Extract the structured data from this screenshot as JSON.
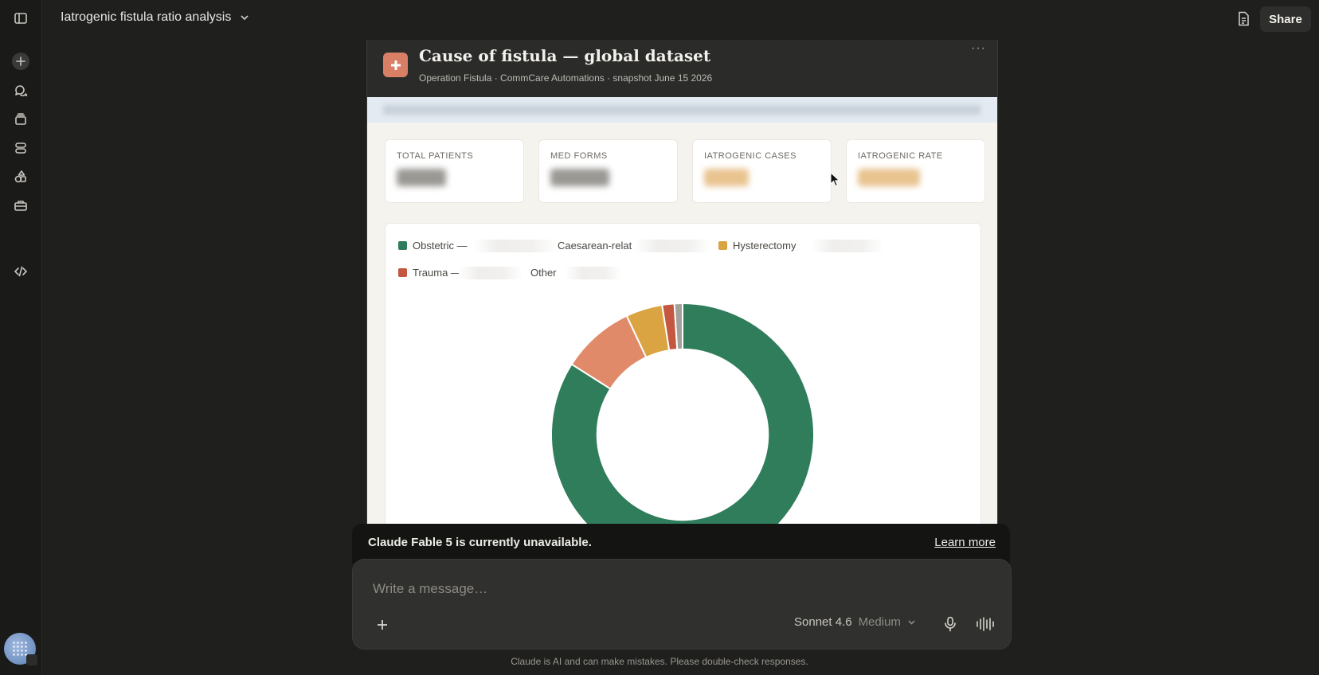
{
  "conversation": {
    "title": "Iatrogenic fistula ratio analysis"
  },
  "header": {
    "share_label": "Share"
  },
  "artifact": {
    "title": "Cause of fistula — global dataset",
    "subtitle": "Operation Fistula · CommCare Automations · snapshot June 15 2026",
    "more_label": "···",
    "kpis": [
      {
        "label": "TOTAL PATIENTS",
        "color": "#9a9893"
      },
      {
        "label": "MED FORMS",
        "color": "#9a9893"
      },
      {
        "label": "IATROGENIC CASES",
        "color": "#e8c38e"
      },
      {
        "label": "IATROGENIC RATE",
        "color": "#e8c38e"
      }
    ]
  },
  "chart_data": {
    "type": "pie",
    "legend": [
      {
        "name": "Obstetric —",
        "color": "#2f7d5b"
      },
      {
        "name": "Caesarean-relat",
        "color": "#e08a6a"
      },
      {
        "name": "Hysterectomy",
        "color": "#d9a441"
      },
      {
        "name": "Trauma —",
        "color": "#c4573f"
      },
      {
        "name": "Other",
        "color": "#a3a19c"
      }
    ],
    "slices": [
      {
        "name": "Obstetric",
        "value": 84,
        "color": "#2f7d5b"
      },
      {
        "name": "Caesarean-related",
        "value": 9,
        "color": "#e08a6a"
      },
      {
        "name": "Hysterectomy",
        "value": 4.5,
        "color": "#d9a441"
      },
      {
        "name": "Trauma",
        "value": 1.5,
        "color": "#c4573f"
      },
      {
        "name": "Other",
        "value": 1,
        "color": "#a3a19c"
      }
    ],
    "hole": 0.65
  },
  "notice": {
    "text": "Claude Fable 5 is currently unavailable.",
    "link": "Learn more"
  },
  "composer": {
    "placeholder": "Write a message…",
    "model": "Sonnet 4.6",
    "effort": "Medium"
  },
  "footer": {
    "disclaimer": "Claude is AI and can make mistakes. Please double-check responses."
  },
  "icons": {
    "sidebar": [
      "sidebar-toggle-icon",
      "new-chat-icon",
      "chats-icon",
      "projects-icon",
      "artifacts-icon",
      "shapes-icon",
      "toolbox-icon",
      "code-icon"
    ],
    "header": [
      "document-icon"
    ]
  }
}
